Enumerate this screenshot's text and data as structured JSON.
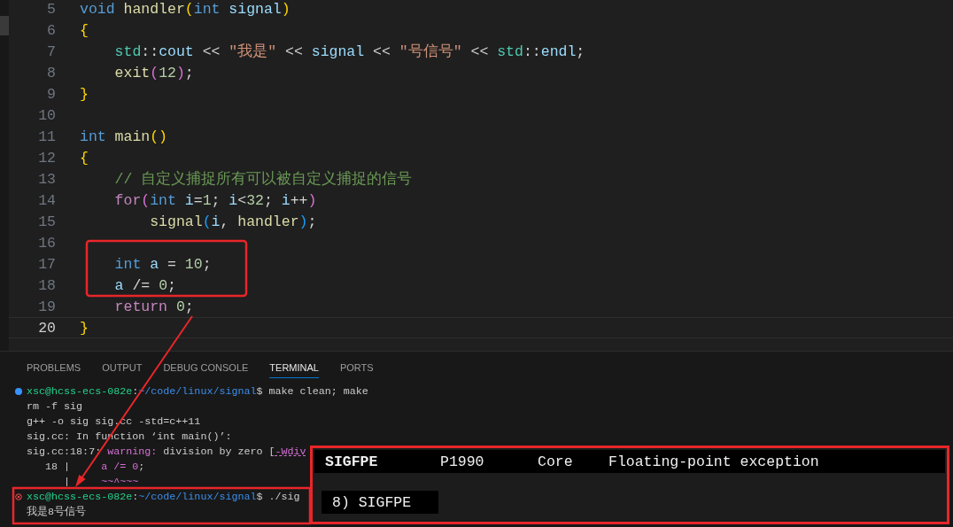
{
  "editor": {
    "lines": [
      {
        "number": "5",
        "current": false,
        "tokens": [
          {
            "text": "void ",
            "kind": "keyword"
          },
          {
            "text": "handler",
            "kind": "func"
          },
          {
            "text": "(",
            "kind": "bracket"
          },
          {
            "text": "int ",
            "kind": "keyword"
          },
          {
            "text": "signal",
            "kind": "var"
          },
          {
            "text": ")",
            "kind": "bracket"
          }
        ]
      },
      {
        "number": "6",
        "current": false,
        "tokens": [
          {
            "text": "{",
            "kind": "bracket"
          }
        ]
      },
      {
        "number": "7",
        "current": false,
        "tokens": [
          {
            "text": "    std",
            "kind": "type"
          },
          {
            "text": "::",
            "kind": "plain"
          },
          {
            "text": "cout",
            "kind": "var"
          },
          {
            "text": " << ",
            "kind": "plain"
          },
          {
            "text": "\"我是\"",
            "kind": "string"
          },
          {
            "text": " << ",
            "kind": "plain"
          },
          {
            "text": "signal",
            "kind": "var"
          },
          {
            "text": " << ",
            "kind": "plain"
          },
          {
            "text": "\"号信号\"",
            "kind": "string"
          },
          {
            "text": " << ",
            "kind": "plain"
          },
          {
            "text": "std",
            "kind": "type"
          },
          {
            "text": "::",
            "kind": "plain"
          },
          {
            "text": "endl",
            "kind": "var"
          },
          {
            "text": ";",
            "kind": "plain"
          }
        ]
      },
      {
        "number": "8",
        "current": false,
        "tokens": [
          {
            "text": "    exit",
            "kind": "func"
          },
          {
            "text": "(",
            "kind": "bracket2"
          },
          {
            "text": "12",
            "kind": "number"
          },
          {
            "text": ")",
            "kind": "bracket2"
          },
          {
            "text": ";",
            "kind": "plain"
          }
        ]
      },
      {
        "number": "9",
        "current": false,
        "tokens": [
          {
            "text": "}",
            "kind": "bracket"
          }
        ]
      },
      {
        "number": "10",
        "current": false
      },
      {
        "number": "11",
        "current": false,
        "tokens": [
          {
            "text": "int ",
            "kind": "keyword"
          },
          {
            "text": "main",
            "kind": "func"
          },
          {
            "text": "()",
            "kind": "bracket"
          }
        ]
      },
      {
        "number": "12",
        "current": false,
        "tokens": [
          {
            "text": "{",
            "kind": "bracket"
          }
        ]
      },
      {
        "number": "13",
        "current": false,
        "tokens": [
          {
            "text": "    // 自定义捕捉所有可以被自定义捕捉的信号",
            "kind": "comment"
          }
        ]
      },
      {
        "number": "14",
        "current": false,
        "tokens": [
          {
            "text": "    for",
            "kind": "control"
          },
          {
            "text": "(",
            "kind": "bracket2"
          },
          {
            "text": "int ",
            "kind": "keyword"
          },
          {
            "text": "i",
            "kind": "var"
          },
          {
            "text": "=",
            "kind": "plain"
          },
          {
            "text": "1",
            "kind": "number"
          },
          {
            "text": "; ",
            "kind": "plain"
          },
          {
            "text": "i",
            "kind": "var"
          },
          {
            "text": "<",
            "kind": "plain"
          },
          {
            "text": "32",
            "kind": "number"
          },
          {
            "text": "; ",
            "kind": "plain"
          },
          {
            "text": "i",
            "kind": "var"
          },
          {
            "text": "++",
            "kind": "plain"
          },
          {
            "text": ")",
            "kind": "bracket2"
          }
        ]
      },
      {
        "number": "15",
        "current": false,
        "tokens": [
          {
            "text": "        signal",
            "kind": "func"
          },
          {
            "text": "(",
            "kind": "bracket3"
          },
          {
            "text": "i",
            "kind": "var"
          },
          {
            "text": ", ",
            "kind": "plain"
          },
          {
            "text": "handler",
            "kind": "func"
          },
          {
            "text": ")",
            "kind": "bracket3"
          },
          {
            "text": ";",
            "kind": "plain"
          }
        ]
      },
      {
        "number": "16",
        "current": false
      },
      {
        "number": "17",
        "current": false,
        "tokens": [
          {
            "text": "    int ",
            "kind": "keyword"
          },
          {
            "text": "a",
            "kind": "var"
          },
          {
            "text": " = ",
            "kind": "plain"
          },
          {
            "text": "10",
            "kind": "number"
          },
          {
            "text": ";",
            "kind": "plain"
          }
        ]
      },
      {
        "number": "18",
        "current": false,
        "tokens": [
          {
            "text": "    a",
            "kind": "var"
          },
          {
            "text": " /= ",
            "kind": "plain"
          },
          {
            "text": "0",
            "kind": "number"
          },
          {
            "text": ";",
            "kind": "plain"
          }
        ]
      },
      {
        "number": "19",
        "current": false,
        "tokens": [
          {
            "text": "    return ",
            "kind": "control"
          },
          {
            "text": "0",
            "kind": "number"
          },
          {
            "text": ";",
            "kind": "plain"
          }
        ]
      },
      {
        "number": "20",
        "current": true,
        "tokens": [
          {
            "text": "}",
            "kind": "bracket"
          }
        ]
      }
    ]
  },
  "panel": {
    "tabs": [
      {
        "label": "PROBLEMS",
        "selected": false
      },
      {
        "label": "OUTPUT",
        "selected": false
      },
      {
        "label": "DEBUG CONSOLE",
        "selected": false
      },
      {
        "label": "TERMINAL",
        "selected": true
      },
      {
        "label": "PORTS",
        "selected": false
      }
    ],
    "terminal": [
      {
        "kind": "prompt",
        "failed": false,
        "parts": [
          {
            "text": "xsc@hcss-ecs-082e",
            "kind": "user"
          },
          {
            "text": ":",
            "kind": "plain"
          },
          {
            "text": "~/code/linux/signal",
            "kind": "path"
          },
          {
            "text": "$ make clean; make",
            "kind": "plain"
          }
        ]
      },
      {
        "kind": "output",
        "parts": [
          {
            "text": "rm -f sig",
            "kind": "plain"
          }
        ]
      },
      {
        "kind": "output",
        "parts": [
          {
            "text": "g++ -o sig sig.cc -std=c++11",
            "kind": "plain"
          }
        ]
      },
      {
        "kind": "output",
        "parts": [
          {
            "text": "sig.cc: In function ‘int main()’:",
            "kind": "plain"
          }
        ]
      },
      {
        "kind": "output",
        "parts": [
          {
            "text": "sig.cc:18:7: ",
            "kind": "plain"
          },
          {
            "text": "warning:",
            "kind": "warning"
          },
          {
            "text": " division by zero [",
            "kind": "plain"
          },
          {
            "text": "-Wdiv",
            "kind": "flag"
          }
        ]
      },
      {
        "kind": "output",
        "parts": [
          {
            "text": "   18 |     ",
            "kind": "plain"
          },
          {
            "text": "a /= 0",
            "kind": "highlight"
          },
          {
            "text": ";",
            "kind": "plain"
          }
        ]
      },
      {
        "kind": "output",
        "parts": [
          {
            "text": "      |     ",
            "kind": "plain"
          },
          {
            "text": "~~^~~~",
            "kind": "highlight"
          }
        ]
      },
      {
        "kind": "prompt",
        "failed": true,
        "parts": [
          {
            "text": "xsc@hcss-ecs-082e",
            "kind": "user"
          },
          {
            "text": ":",
            "kind": "plain"
          },
          {
            "text": "~/code/linux/signal",
            "kind": "path"
          },
          {
            "text": "$ ./sig",
            "kind": "plain"
          }
        ]
      },
      {
        "kind": "output",
        "parts": [
          {
            "text": "我是8号信号",
            "kind": "plain"
          }
        ]
      }
    ]
  },
  "signal_table": {
    "row": [
      "SIGFPE",
      "P1990",
      "Core",
      "Floating-point exception"
    ],
    "entry": "8) SIGFPE"
  }
}
